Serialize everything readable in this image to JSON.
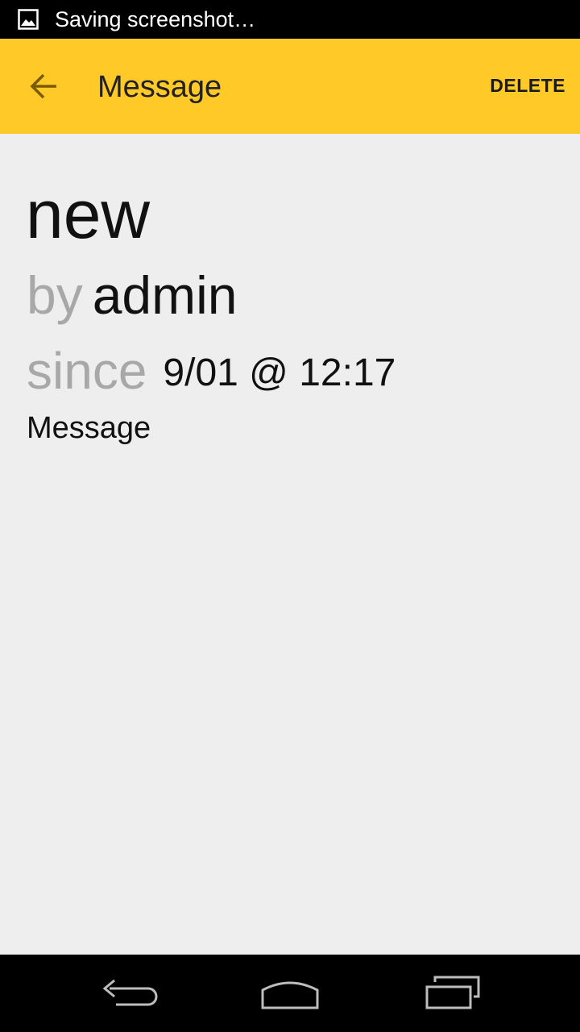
{
  "status_bar": {
    "notification_icon": "image-icon",
    "text": "Saving screenshot…"
  },
  "action_bar": {
    "back_icon": "arrow-back-icon",
    "title": "Message",
    "delete_label": "DELETE",
    "background_color": "#ffca28"
  },
  "message": {
    "subject": "new",
    "by_label": "by",
    "author": "admin",
    "since_label": "since",
    "date": "9/01 @ 12:17",
    "body": "Message"
  },
  "nav_bar": {
    "back_icon": "nav-back-icon",
    "home_icon": "nav-home-icon",
    "recents_icon": "nav-recents-icon"
  }
}
